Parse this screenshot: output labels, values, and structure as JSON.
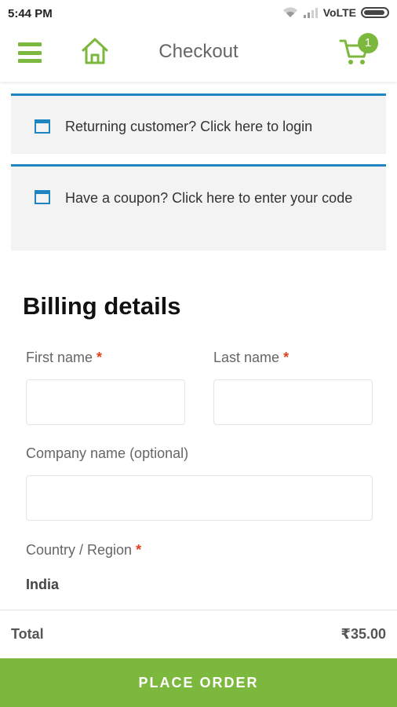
{
  "status_bar": {
    "time": "5:44 PM",
    "network_label": "VoLTE",
    "icons": [
      "wifi-icon",
      "signal-icon",
      "battery-icon"
    ]
  },
  "app_bar": {
    "title": "Checkout",
    "cart_count": "1",
    "icons": [
      "hamburger-icon",
      "home-icon",
      "cart-icon"
    ]
  },
  "notices": {
    "login_text": "Returning customer? Click here to login",
    "coupon_text": "Have a coupon? Click here to enter your code"
  },
  "billing": {
    "title": "Billing details",
    "first_name_label": "First name",
    "last_name_label": "Last name",
    "company_label": "Company name (optional)",
    "country_label": "Country / Region",
    "country_value": "India",
    "required_mark": "*"
  },
  "footer": {
    "total_label": "Total",
    "total_value": "₹35.00",
    "place_order_label": "PLACE ORDER"
  },
  "colors": {
    "brand_green": "#7cb83e",
    "notice_blue": "#1e85be",
    "required_red": "#e2401c"
  }
}
